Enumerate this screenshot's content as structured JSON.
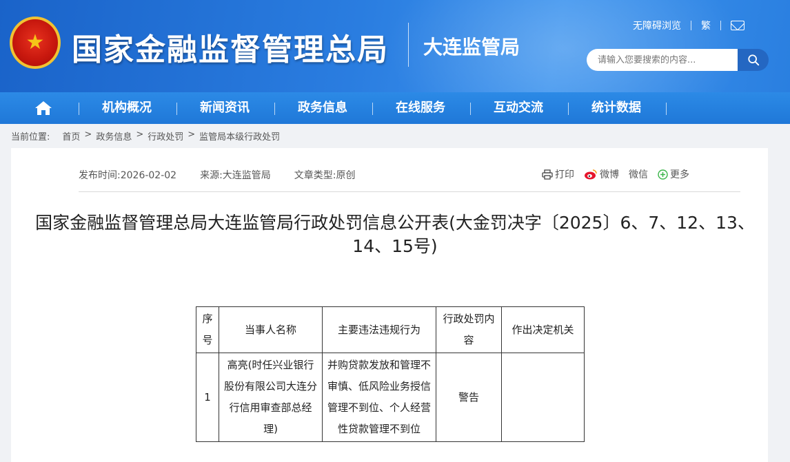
{
  "header": {
    "emblem_glyph": "★",
    "site_title": "国家金融监督管理总局",
    "branch_title": "大连监管局",
    "accessibility_link": "无障碍浏览",
    "traditional_link": "繁",
    "search_placeholder": "请输入您要搜索的内容..."
  },
  "nav": {
    "items": [
      "机构概况",
      "新闻资讯",
      "政务信息",
      "在线服务",
      "互动交流",
      "统计数据"
    ]
  },
  "breadcrumb": {
    "label": "当前位置:",
    "items": [
      "首页",
      ">",
      "政务信息",
      ">",
      "行政处罚",
      ">",
      "监管局本级行政处罚"
    ]
  },
  "article": {
    "publish_time": "发布时间:2026-02-02",
    "source": "来源:大连监管局",
    "type": "文章类型:原创",
    "share": {
      "print": "打印",
      "weibo": "微博",
      "wechat": "微信",
      "more": "更多"
    },
    "title": "国家金融监督管理总局大连监管局行政处罚信息公开表(大金罚决字〔2025〕6、7、12、13、14、15号)"
  },
  "table": {
    "headers": [
      "序号",
      "当事人名称",
      "主要违法违规行为",
      "行政处罚内容",
      "作出决定机关"
    ],
    "rows": [
      [
        "1",
        "高亮(时任兴业银行股份有限公司大连分行信用审查部总经理)",
        "并购贷款发放和管理不审慎、低风险业务授信管理不到位、个人经营性贷款管理不到位",
        "警告",
        ""
      ]
    ]
  },
  "colors": {
    "header_blue": "#2a7de0",
    "nav_blue": "#2381de",
    "search_button": "#2467c2"
  }
}
